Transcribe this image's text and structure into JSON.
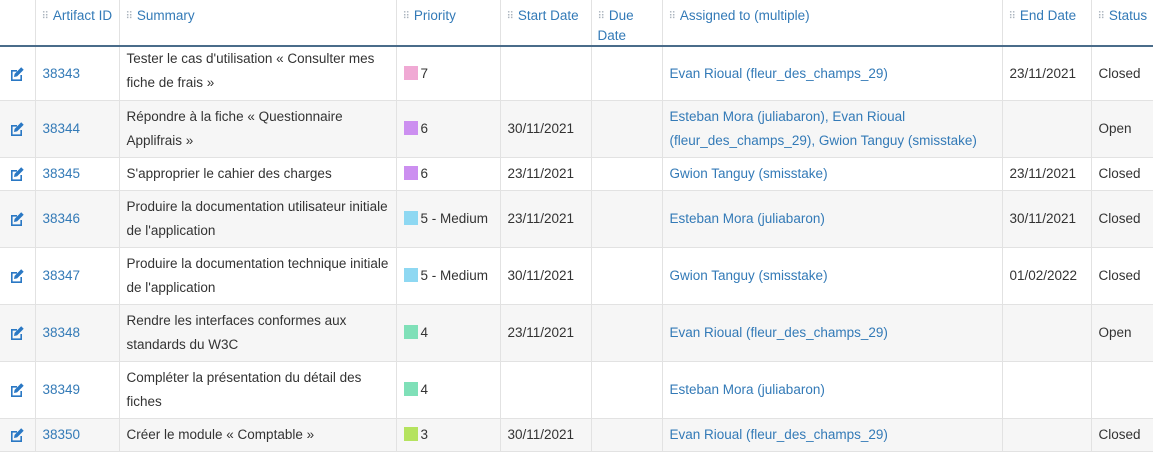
{
  "columns": {
    "artifact_id": "Artifact ID",
    "summary": "Summary",
    "priority": "Priority",
    "start_date": "Start Date",
    "due_date": "Due Date",
    "assigned_to": "Assigned to (multiple)",
    "end_date": "End Date",
    "status": "Status"
  },
  "icons": {
    "edit": "edit-icon",
    "grip": "drag-handle-icon"
  },
  "rows": [
    {
      "id": "38343",
      "summary": "Tester le cas d'utilisation « Consulter mes fiche de frais »",
      "priority": "7",
      "priority_color": "#f0a9d4",
      "start": "",
      "due": "",
      "assigned": "Evan Rioual (fleur_des_champs_29)",
      "end": "23/11/2021",
      "status": "Closed"
    },
    {
      "id": "38344",
      "summary": "Répondre à la fiche « Questionnaire Applifrais »",
      "priority": "6",
      "priority_color": "#cc8ff0",
      "start": "30/11/2021",
      "due": "",
      "assigned": "Esteban Mora (juliabaron), Evan Rioual (fleur_des_champs_29), Gwion Tanguy (smisstake)",
      "end": "",
      "status": "Open"
    },
    {
      "id": "38345",
      "summary": "S'approprier le cahier des charges",
      "priority": "6",
      "priority_color": "#cc8ff0",
      "start": "23/11/2021",
      "due": "",
      "assigned": "Gwion Tanguy (smisstake)",
      "end": "23/11/2021",
      "status": "Closed"
    },
    {
      "id": "38346",
      "summary": "Produire la documentation utilisateur initiale de l'application",
      "priority": "5 - Medium",
      "priority_color": "#8ed8f2",
      "start": "23/11/2021",
      "due": "",
      "assigned": "Esteban Mora (juliabaron)",
      "end": "30/11/2021",
      "status": "Closed"
    },
    {
      "id": "38347",
      "summary": "Produire la documentation technique initiale de l'application",
      "priority": "5 - Medium",
      "priority_color": "#8ed8f2",
      "start": "30/11/2021",
      "due": "",
      "assigned": "Gwion Tanguy (smisstake)",
      "end": "01/02/2022",
      "status": "Closed"
    },
    {
      "id": "38348",
      "summary": "Rendre les interfaces conformes aux standards du W3C",
      "priority": "4",
      "priority_color": "#7fe0b8",
      "start": "23/11/2021",
      "due": "",
      "assigned": "Evan Rioual (fleur_des_champs_29)",
      "end": "",
      "status": "Open"
    },
    {
      "id": "38349",
      "summary": "Compléter la présentation du détail des fiches",
      "priority": "4",
      "priority_color": "#7fe0b8",
      "start": "",
      "due": "",
      "assigned": "Esteban Mora (juliabaron)",
      "end": "",
      "status": ""
    },
    {
      "id": "38350",
      "summary": "Créer le module « Comptable »",
      "priority": "3",
      "priority_color": "#b5e35f",
      "start": "30/11/2021",
      "due": "",
      "assigned": "Evan Rioual (fleur_des_champs_29)",
      "end": "",
      "status": "Closed"
    }
  ]
}
